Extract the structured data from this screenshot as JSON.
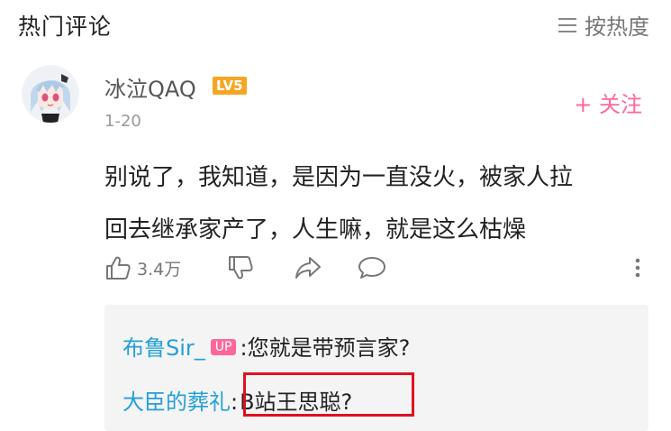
{
  "header": {
    "title": "热门评论",
    "sort_label": "按热度"
  },
  "comment": {
    "user": {
      "name": "冰泣QAQ",
      "level": "LV5",
      "avatar_icon": "avatar-anime-icon"
    },
    "date": "1-20",
    "follow_label": "+ 关注",
    "text_line1": "别说了，我知道，是因为一直没火，被家人拉",
    "text_line2": "回去继承家产了，人生嘛，就是这么枯燥",
    "like_count": "3.4万"
  },
  "replies": [
    {
      "name": "布鲁Sir_",
      "badge": "UP",
      "separator": ":",
      "text": "您就是带预言家?"
    },
    {
      "name": "大臣的葬礼",
      "separator": ":",
      "text": "B站王思聪?"
    }
  ],
  "colors": {
    "accent_pink": "#ff6699",
    "reply_name_blue": "#23a0d8",
    "level_orange": "#f5a623",
    "highlight_red": "#e01020"
  }
}
